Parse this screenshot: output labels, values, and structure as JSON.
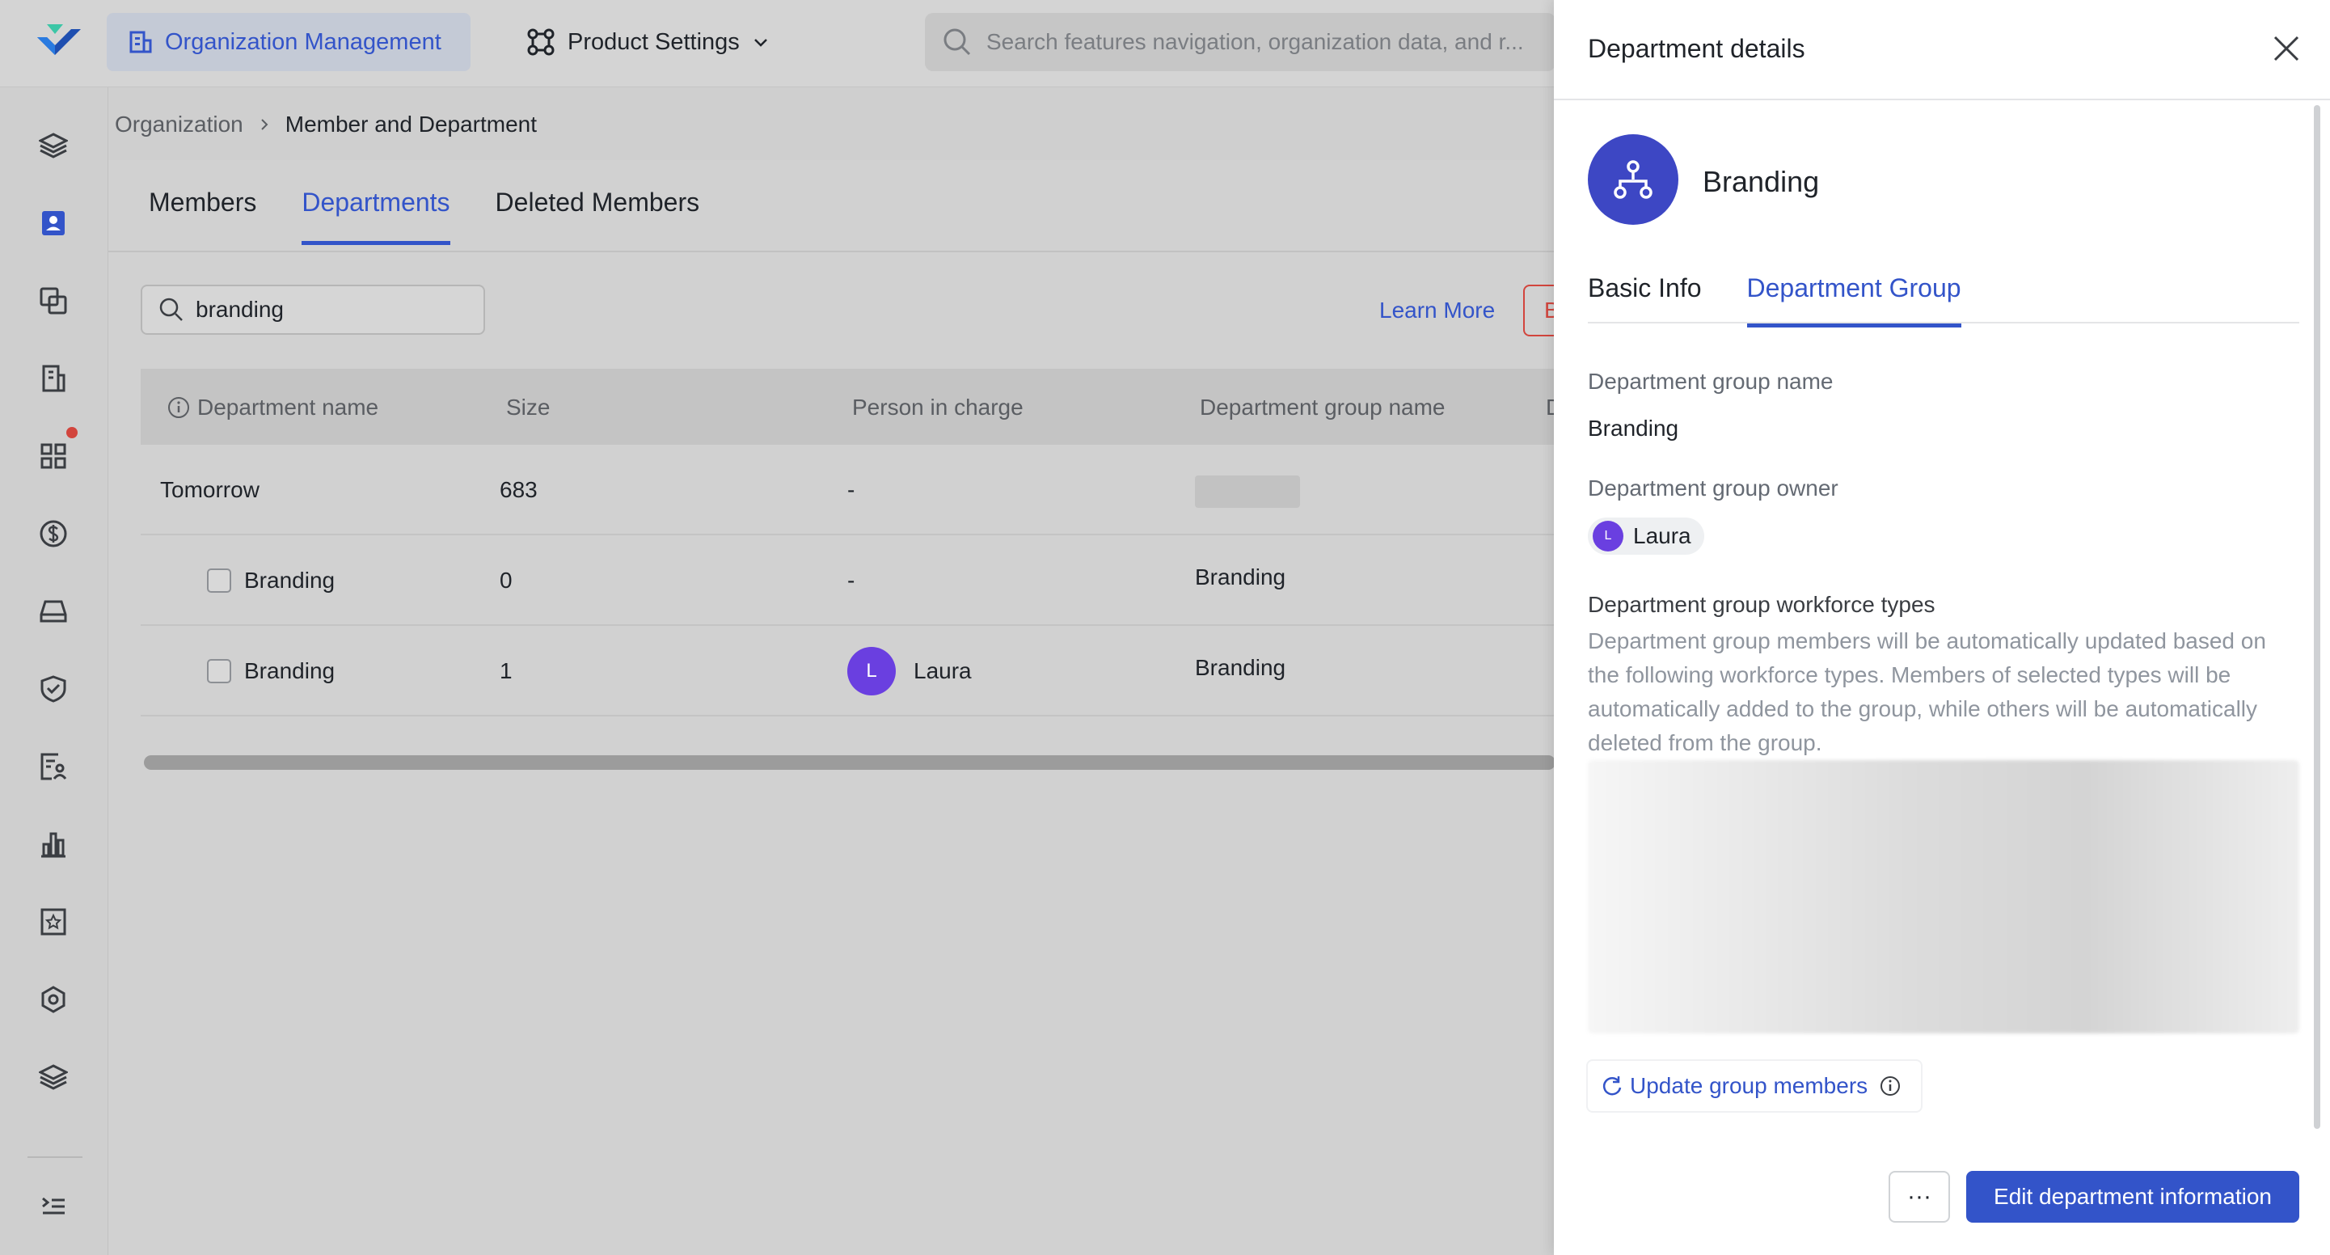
{
  "topbar": {
    "org_label": "Organization Management",
    "product_label": "Product Settings",
    "search_placeholder": "Search features navigation, organization data, and r..."
  },
  "rail": {
    "icons": [
      "layers-icon",
      "contacts-icon",
      "copy-icon",
      "building-icon",
      "apps-icon",
      "dollar-icon",
      "drive-icon",
      "shield-icon",
      "form-icon",
      "chart-icon",
      "star-box-icon",
      "settings-hex-icon",
      "layers-icon",
      "expand-icon"
    ]
  },
  "breadcrumb": {
    "root": "Organization",
    "current": "Member and Department"
  },
  "tabs": {
    "members": "Members",
    "departments": "Departments",
    "deleted": "Deleted Members"
  },
  "toolbar": {
    "search_value": "branding",
    "learn_more": "Learn More",
    "red_button": "B"
  },
  "table": {
    "headers": {
      "name": "Department name",
      "size": "Size",
      "person": "Person in charge",
      "group": "Department group name",
      "extra": "D"
    },
    "rows": [
      {
        "name": "Tomorrow",
        "size": "683",
        "person": "-",
        "group": ""
      },
      {
        "name": "Branding",
        "size": "0",
        "person": "-",
        "group": "Branding"
      },
      {
        "name": "Branding",
        "size": "1",
        "person": "Laura",
        "person_initial": "L",
        "group": "Branding"
      }
    ]
  },
  "panel": {
    "title": "Department details",
    "dept_name": "Branding",
    "tab_basic": "Basic Info",
    "tab_group": "Department Group",
    "group_name_label": "Department group name",
    "group_name_value": "Branding",
    "owner_label": "Department group owner",
    "owner_initial": "L",
    "owner_name": "Laura",
    "workforce_label": "Department group workforce types",
    "workforce_desc": "Department group members will be automatically updated based on the following workforce types. Members of selected types will be automatically added to the group, while others will be automatically deleted from the group.",
    "update_label": "Update group members",
    "more_label": "···",
    "edit_label": "Edit department information"
  },
  "colors": {
    "accent": "#3354c9",
    "danger": "#d2453d",
    "avatar": "#6a3fe0",
    "dept_icon": "#3d47c4"
  }
}
